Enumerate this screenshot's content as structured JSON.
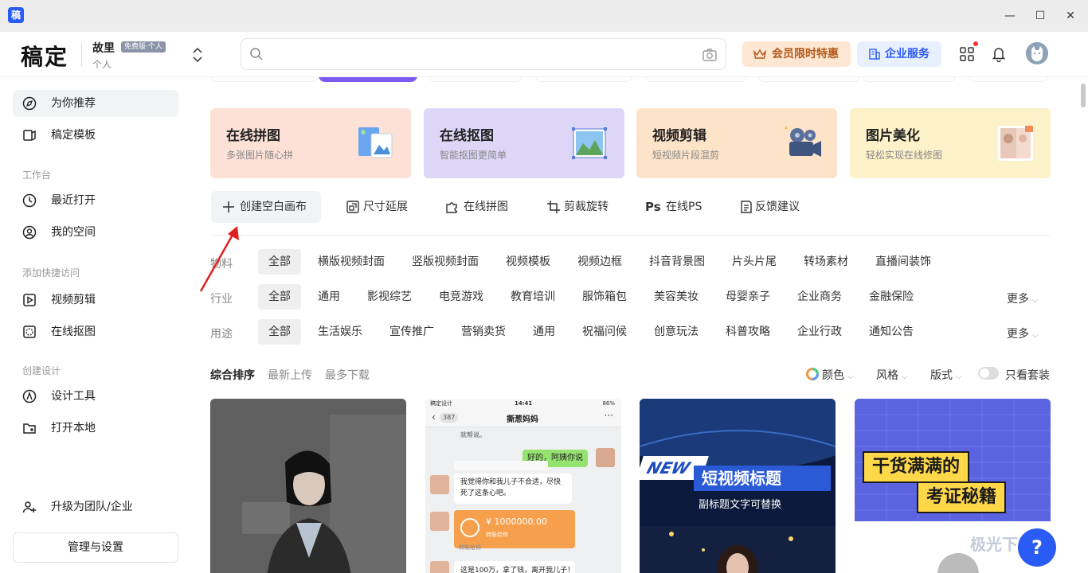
{
  "app": {
    "icon_text": "稿",
    "logo": "稿定"
  },
  "window": {
    "minimize": "—",
    "maximize": "☐",
    "close": "✕"
  },
  "user": {
    "name": "故里",
    "badge": "免费版·个人",
    "sub": "个人"
  },
  "header": {
    "search_placeholder": "",
    "vip_label": "会员限时特惠",
    "enterprise_label": "企业服务"
  },
  "sidebar": {
    "items": [
      {
        "label": "为你推荐",
        "icon": "compass-icon",
        "active": true
      },
      {
        "label": "稿定模板",
        "icon": "template-icon"
      },
      {
        "label": "最近打开",
        "icon": "clock-icon"
      },
      {
        "label": "我的空间",
        "icon": "user-circle-icon"
      },
      {
        "label": "视频剪辑",
        "icon": "play-icon"
      },
      {
        "label": "在线抠图",
        "icon": "cutout-icon"
      },
      {
        "label": "设计工具",
        "icon": "pen-icon"
      },
      {
        "label": "打开本地",
        "icon": "folder-add-icon"
      },
      {
        "label": "升级为团队/企业",
        "icon": "user-add-icon"
      }
    ],
    "sections": {
      "workbench": "工作台",
      "quick": "添加快捷访问",
      "create": "创建设计"
    },
    "manage_label": "管理与设置"
  },
  "features": [
    {
      "title": "在线拼图",
      "subtitle": "多张图片随心拼",
      "color": "#fde0d6"
    },
    {
      "title": "在线抠图",
      "subtitle": "智能抠图更简单",
      "color": "#ddd6f7"
    },
    {
      "title": "视频剪辑",
      "subtitle": "短视频片段混剪",
      "color": "#fde3c8"
    },
    {
      "title": "图片美化",
      "subtitle": "轻松实现在线修图",
      "color": "#fcf1c8"
    }
  ],
  "tools": {
    "create": "创建空白画布",
    "extend": "尺寸延展",
    "collage": "在线拼图",
    "crop": "剪裁旋转",
    "ps": "在线PS",
    "feedback": "反馈建议"
  },
  "filters": {
    "material": {
      "label": "物料",
      "chips": [
        "全部",
        "横版视频封面",
        "竖版视频封面",
        "视频模板",
        "视频边框",
        "抖音背景图",
        "片头片尾",
        "转场素材",
        "直播间装饰"
      ]
    },
    "industry": {
      "label": "行业",
      "chips": [
        "全部",
        "通用",
        "影视综艺",
        "电竞游戏",
        "教育培训",
        "服饰箱包",
        "美容美妆",
        "母婴亲子",
        "企业商务",
        "金融保险"
      ],
      "more": "更多"
    },
    "usage": {
      "label": "用途",
      "chips": [
        "全部",
        "生活娱乐",
        "宣传推广",
        "营销卖货",
        "通用",
        "祝福问候",
        "创意玩法",
        "科普攻略",
        "企业行政",
        "通知公告"
      ],
      "more": "更多"
    }
  },
  "sort": {
    "comprehensive": "综合排序",
    "newest": "最新上传",
    "most_downloaded": "最多下载",
    "color": "颜色",
    "style": "风格",
    "layout": "版式",
    "only_sets": "只看套装"
  },
  "thumbs": {
    "chat_title": "撕葱妈妈",
    "chat_count": "387",
    "chat_time": "14:41",
    "chat_status": "稿定设计",
    "chat_battery": "86%",
    "chat_top": "就帮说。",
    "chat_reply": "好的，阿姨你说",
    "chat_msg1": "我觉得你和我儿子不合适，尽快死了这条心吧。",
    "chat_money": "¥ 1000000.00",
    "chat_money_sub": "转账给你",
    "chat_money_foot": "转账给你",
    "chat_msg2": "这是100万，拿了钱，离开我儿子！",
    "news_badge": "NEW",
    "news_title": "短视频标题",
    "news_sub": "副标题文字可替换",
    "poster_line1": "干货满满的",
    "poster_line2": "考证秘籍"
  },
  "help": "?",
  "watermark": "极光下载站"
}
